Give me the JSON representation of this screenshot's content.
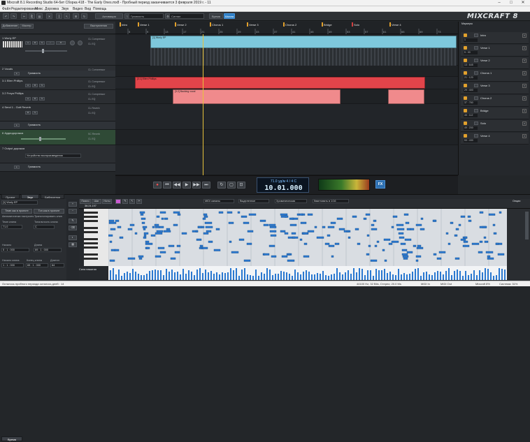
{
  "window": {
    "title": "Mixcraft 8.1 Recording Studio 64-бит Сборка 418 - The Early Ones.mx8 - Пробный период заканчивается 3 февраля 2019 г. - 11"
  },
  "menu": [
    "Файл",
    "Редактирование",
    "Микс",
    "Дорожка",
    "Звук",
    "Видео",
    "Вид",
    "Помощь"
  ],
  "toolbar": {
    "activate": "Активация",
    "volume_sel": "Громкость",
    "cutoff_sel": "Сигнал",
    "time_btn": "Время",
    "grid_btn": "Шкала",
    "logo": "MIXCRAFT 8"
  },
  "trackpanel": {
    "tab1": "Добавление",
    "tab2": "Мастер",
    "btn": "Выступления"
  },
  "tracks": [
    {
      "name": "1 Wurly EP",
      "fx1": "CL Compressor",
      "fx2": "CL EQ"
    },
    {
      "name": "2 Vocals",
      "fx1": "CL Compressor",
      "fx2": "CL EQ",
      "auto": "Громкость"
    },
    {
      "name": "3.1 Ellen Phillips",
      "fx1": "CL Compressor",
      "fx2": "CL EQ"
    },
    {
      "name": "3.2 Freya Phillips",
      "fx1": "CL Compressor",
      "fx2": "CL EQ"
    },
    {
      "name": "4 Send 1 - Gott Reverb",
      "fx1": "CL Reverb",
      "fx2": "CL EQ",
      "auto": "Громкость"
    },
    {
      "name": "6 Аудиодорожка",
      "fx1": "SC Reverb",
      "fx2": "CL EQ"
    },
    {
      "name": "7 Output дорожка",
      "fx1": "",
      "fx2": "",
      "device": "Устройство воспроизведения",
      "auto": "Громкость"
    }
  ],
  "markers_ruler": [
    "Intro",
    "Verse 1",
    "Verse 2",
    "Chorus 1",
    "Verse 3",
    "Chorus 2",
    "Bridge",
    "Solo",
    "Verse 4"
  ],
  "bar_numbers": [
    "5",
    "9",
    "13",
    "17",
    "21",
    "25",
    "29",
    "33",
    "37",
    "41",
    "45",
    "49",
    "53",
    "57",
    "61",
    "65",
    "69",
    "73"
  ],
  "clips": {
    "wurly": "[1] Wurly EP",
    "ellen": "[3.1] Ellen Phillips",
    "freya": "[3.2] Backing vocal"
  },
  "markers_panel": {
    "title": "Маркеры",
    "items": [
      {
        "name": "Intro",
        "time": "1"
      },
      {
        "name": "Verse 1",
        "time": "5 : 00"
      },
      {
        "name": "Verse 2",
        "time": "13 : 645"
      },
      {
        "name": "Chorus 1",
        "time": "21 : 120"
      },
      {
        "name": "Verse 3",
        "time": "29 : 400"
      },
      {
        "name": "Chorus 2",
        "time": "37 : 760"
      },
      {
        "name": "Bridge",
        "time": "45 : 112"
      },
      {
        "name": "Solo",
        "time": "49 : 200"
      },
      {
        "name": "Verse 4",
        "time": "53 : 430"
      }
    ]
  },
  "transport": {
    "tempo": "71.0 уд/м  4 / 4  C",
    "time": "10.01.000",
    "fx": "FX"
  },
  "bottom": {
    "tabs": [
      "Проект",
      "Звук",
      "Библиотека"
    ],
    "clip_label": "[1] Wurly EP",
    "btn_tempo": "Темп как в проекте",
    "btn_key": "Тон как в проекте",
    "tempo_sub": "Автоматически настроить",
    "key_sub": "Транспонировать клип",
    "lbl_tempo": "Темп клипа",
    "lbl_key": "Тональность клипа",
    "val_tempo": "71.0",
    "val_key": "C",
    "time_tab": "Время",
    "lbl_start": "Начало",
    "val_start": "5 : 1 : 000",
    "lbl_len": "Длина",
    "val_len": "69 : 1 : 000",
    "lbl_cstart": "Начало клипа",
    "lbl_cend": "Конец клипа",
    "lbl_dur": "Длител",
    "val_cstart": "1 : 1 : 000",
    "val_cend": "65 : 1 : 000",
    "val_dur": "64",
    "roll_tabs": [
      "Пиано",
      "Шаг",
      "Ноты"
    ],
    "pos": "36:24.197",
    "sel_midi": "MIDI каналы",
    "sel_sel": "Выделенное",
    "sel_scale": "Хроматическая",
    "sel_quant": "Квантовать в 1/16",
    "vel_label": "Сила нажатия",
    "extra": "Опции"
  },
  "status": {
    "left": "Осталось пробного периода осталось дней : 14",
    "rate": "44100 Hz, 32 Bits, Стерео; 20.0 Ms",
    "midi_in": "MIDI In",
    "midi_out": "MIDI Out",
    "brand": "Mixcraft 8%",
    "cpu": "Система: 31%"
  }
}
